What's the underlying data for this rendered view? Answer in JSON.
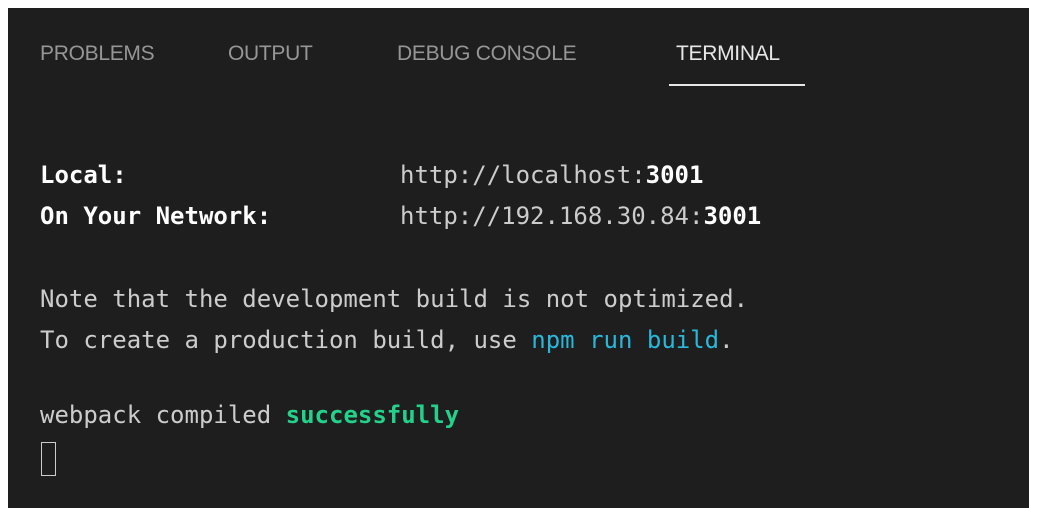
{
  "tabs": {
    "problems": "PROBLEMS",
    "output": "OUTPUT",
    "debug_console": "DEBUG CONSOLE",
    "terminal": "TERMINAL"
  },
  "terminal": {
    "local_label": "Local:",
    "local_url_prefix": "http://localhost:",
    "local_port": "3001",
    "network_label": "On Your Network:",
    "network_url_prefix": "http://192.168.30.84:",
    "network_port": "3001",
    "note_line": "Note that the development build is not optimized.",
    "production_prefix": "To create a production build, use ",
    "production_command": "npm run build",
    "production_suffix": ".",
    "compiled_prefix": "webpack compiled ",
    "compiled_status": "successfully"
  },
  "colors": {
    "background": "#1e1e1e",
    "command": "#29b8db",
    "success": "#23d18b",
    "text": "#cccccc"
  }
}
